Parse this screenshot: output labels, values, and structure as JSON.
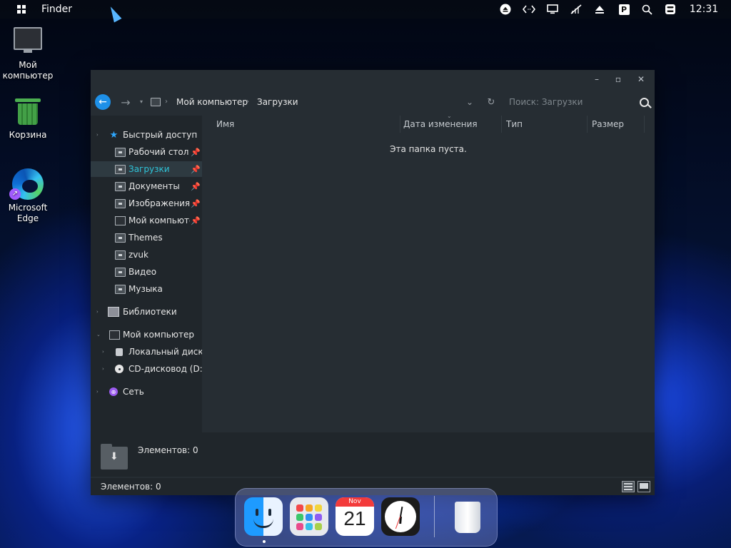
{
  "topbar": {
    "app_name": "Finder",
    "clock": "12:31",
    "tray_icons": [
      "eject-icon",
      "code-arrows-icon",
      "monitor-icon",
      "network-off-icon",
      "upload-icon",
      "p-badge-icon",
      "search-icon",
      "toggle-settings-icon"
    ],
    "p_badge": "P"
  },
  "desktop": {
    "icons": [
      {
        "label": "Мой\nкомпьютер",
        "icon": "monitor-icon"
      },
      {
        "label": "Корзина",
        "icon": "recycle-bin-icon"
      },
      {
        "label": "Microsoft\nEdge",
        "icon": "edge-icon"
      }
    ]
  },
  "window": {
    "title_buttons": {
      "minimize": "–",
      "maximize": "▫",
      "close": "✕"
    },
    "breadcrumb": [
      "Мой компьютер",
      "Загрузки"
    ],
    "search_placeholder": "Поиск: Загрузки",
    "columns": [
      "Имя",
      "Дата изменения",
      "Тип",
      "Размер"
    ],
    "empty_message": "Эта папка пуста.",
    "details_count": "Элементов: 0",
    "status_text": "Элементов: 0",
    "sidebar": {
      "quick_access": {
        "label": "Быстрый доступ",
        "items": [
          {
            "label": "Рабочий стол",
            "pinned": true
          },
          {
            "label": "Загрузки",
            "pinned": true,
            "selected": true
          },
          {
            "label": "Документы",
            "pinned": true
          },
          {
            "label": "Изображения",
            "pinned": true
          },
          {
            "label": "Мой компьютер",
            "pinned": true
          },
          {
            "label": "Themes",
            "pinned": false
          },
          {
            "label": "zvuk",
            "pinned": false
          },
          {
            "label": "Видео",
            "pinned": false
          },
          {
            "label": "Музыка",
            "pinned": false
          }
        ]
      },
      "libraries": "Библиотеки",
      "this_pc": {
        "label": "Мой компьютер",
        "items": [
          "Локальный диск (C:)",
          "CD-дисковод (D:) v"
        ]
      },
      "network": "Сеть"
    }
  },
  "dock": {
    "apps": [
      "Finder",
      "Launchpad",
      "Calendar",
      "Clock",
      "Trash"
    ],
    "calendar": {
      "month": "Nov",
      "day": "21"
    }
  },
  "colors": {
    "accent": "#1e90e8",
    "selected_text": "#2ec4d9",
    "pin": "#ff3b3b",
    "window_bg": "#262d33"
  }
}
